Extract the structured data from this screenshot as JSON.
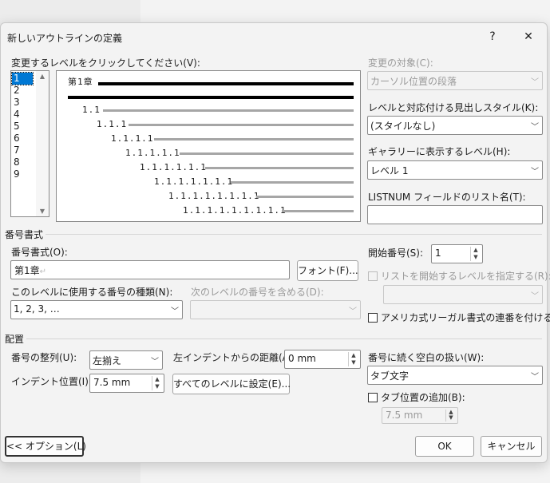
{
  "dialog": {
    "title": "新しいアウトラインの定義",
    "help_glyph": "?",
    "close_glyph": "✕"
  },
  "level_picker": {
    "label": "変更するレベルをクリックしてください(V):",
    "levels": [
      "1",
      "2",
      "3",
      "4",
      "5",
      "6",
      "7",
      "8",
      "9"
    ],
    "selected": "1",
    "scroll_up": "▲",
    "scroll_down": "▼"
  },
  "preview": {
    "rows": [
      "第1章",
      "1.1",
      "1.1.1",
      "1.1.1.1",
      "1.1.1.1.1",
      "1.1.1.1.1.1",
      "1.1.1.1.1.1.1",
      "1.1.1.1.1.1.1.1",
      "1.1.1.1.1.1.1.1.1"
    ]
  },
  "right_panel": {
    "apply_to_label": "変更の対象(C):",
    "apply_to_value": "カーソル位置の段落",
    "link_style_label": "レベルと対応付ける見出しスタイル(K):",
    "link_style_value": "(スタイルなし)",
    "gallery_level_label": "ギャラリーに表示するレベル(H):",
    "gallery_level_value": "レベル 1",
    "listnum_label": "LISTNUM フィールドのリスト名(T):",
    "listnum_value": ""
  },
  "number_format": {
    "section_label": "番号書式",
    "format_label": "番号書式(O):",
    "format_value": "第1章",
    "para_mark": "↵",
    "font_button": "フォント(F)...",
    "style_label": "このレベルに使用する番号の種類(N):",
    "style_value": "1, 2, 3, …",
    "include_label": "次のレベルの番号を含める(D):",
    "include_value": "",
    "start_label": "開始番号(S):",
    "start_value": "1",
    "restart_label": "リストを開始するレベルを指定する(R):",
    "restart_value": "",
    "legal_label": "アメリカ式リーガル書式の連番を付ける(G)"
  },
  "position": {
    "section_label": "配置",
    "align_label": "番号の整列(U):",
    "align_value": "左揃え",
    "aligned_at_label": "左インデントからの距離(A):",
    "aligned_at_value": "0 mm",
    "indent_label": "インデント位置(I):",
    "indent_value": "7.5 mm",
    "set_all_button": "すべてのレベルに設定(E)...",
    "follow_label": "番号に続く空白の扱い(W):",
    "follow_value": "タブ文字",
    "add_tab_label": "タブ位置の追加(B):",
    "add_tab_value": "7.5 mm"
  },
  "footer": {
    "options_button": "<< オプション(L)",
    "ok_button": "OK",
    "cancel_button": "キャンセル"
  }
}
